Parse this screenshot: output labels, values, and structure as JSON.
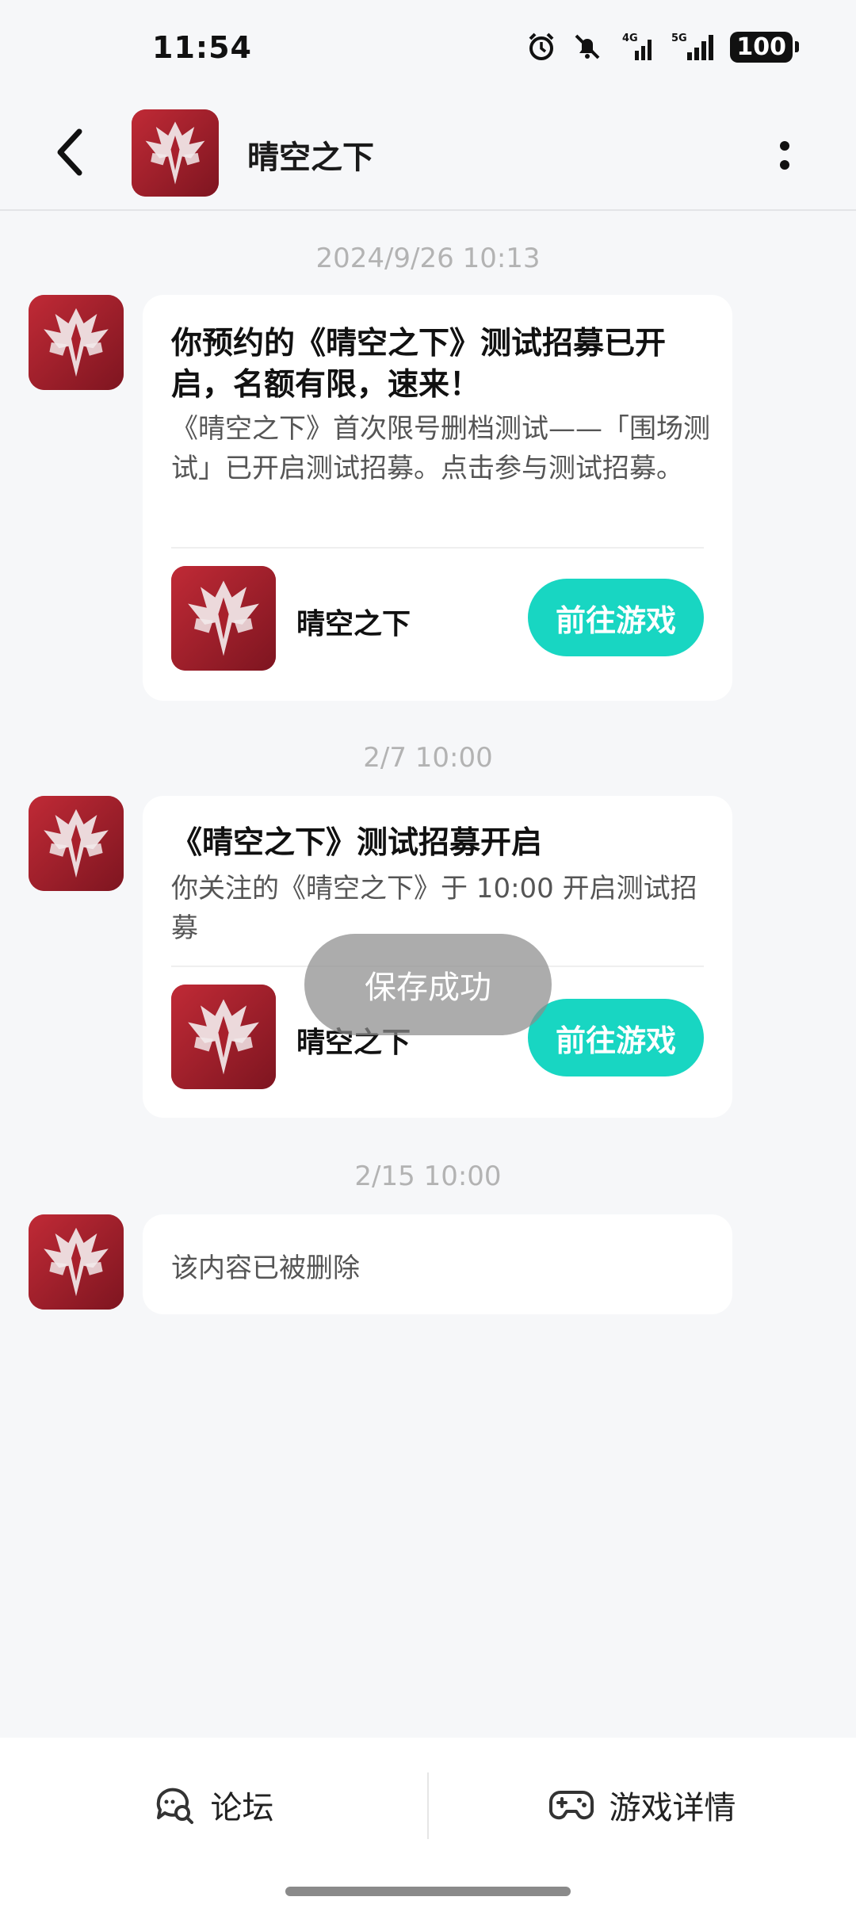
{
  "status_bar": {
    "time": "11:54",
    "network_1": "4G",
    "network_2": "5G",
    "battery": "100"
  },
  "header": {
    "title": "晴空之下",
    "back_icon": "chevron-left-icon",
    "more_icon": "more-vertical-icon"
  },
  "messages": [
    {
      "timestamp": "2024/9/26  10:13",
      "title": "你预约的《晴空之下》测试招募已开启，名额有限，速来！",
      "body": "《晴空之下》首次限号删档测试——「围场测试」已开启测试招募。点击参与测试招募。",
      "game_name": "晴空之下",
      "button_label": "前往游戏"
    },
    {
      "timestamp": "2/7  10:00",
      "title": "《晴空之下》测试招募开启",
      "body": "你关注的《晴空之下》于 10:00 开启测试招募",
      "game_name": "晴空之下",
      "button_label": "前往游戏"
    },
    {
      "timestamp": "2/15  10:00",
      "deleted_text": "该内容已被删除"
    }
  ],
  "toast": "保存成功",
  "bottom_bar": {
    "forum_label": "论坛",
    "game_detail_label": "游戏详情"
  },
  "colors": {
    "accent": "#18D6C2",
    "background": "#F6F7F9",
    "logo_red": "#A8202C"
  }
}
